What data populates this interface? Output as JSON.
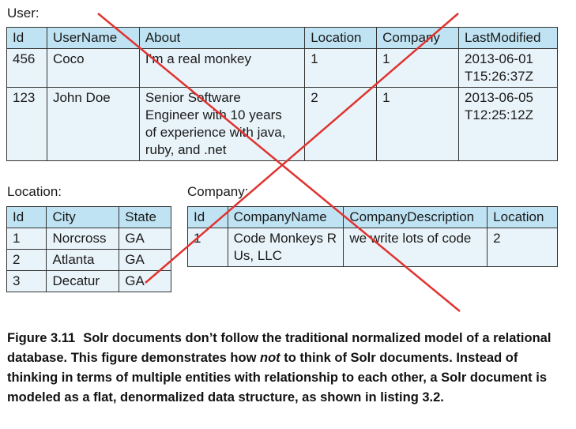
{
  "user": {
    "label": "User:",
    "headers": [
      "Id",
      "UserName",
      "About",
      "Location",
      "Company",
      "LastModified"
    ],
    "rows": [
      [
        "456",
        "Coco",
        "I’m a real monkey",
        "1",
        "1",
        "2013-06-01\nT15:26:37Z"
      ],
      [
        "123",
        "John Doe",
        "Senior Software\nEngineer with 10 years\nof experience with java,\nruby, and .net",
        "2",
        "1",
        "2013-06-05\nT12:25:12Z"
      ]
    ]
  },
  "location": {
    "label": "Location:",
    "headers": [
      "Id",
      "City",
      "State"
    ],
    "rows": [
      [
        "1",
        "Norcross",
        "GA"
      ],
      [
        "2",
        "Atlanta",
        "GA"
      ],
      [
        "3",
        "Decatur",
        "GA"
      ]
    ]
  },
  "company": {
    "label": "Company:",
    "headers": [
      "Id",
      "CompanyName",
      "CompanyDescription",
      "Location"
    ],
    "rows": [
      [
        "1",
        "Code Monkeys R\nUs, LLC",
        "we write lots of code",
        "2"
      ]
    ]
  },
  "caption": {
    "figure": "Figure 3.11",
    "part1": "Solr documents don’t follow the traditional normalized model of a relational database. This figure demonstrates how ",
    "emphasis": "not",
    "part2": " to think of Solr documents. Instead of thinking in terms of multiple entities with relationship to each other, a Solr document is modeled as a flat, denormalized data structure, as shown in listing 3.2."
  },
  "colors": {
    "header_bg": "#bfe3f3",
    "cell_bg": "#e9f4fa",
    "cross": "#e0322f"
  }
}
